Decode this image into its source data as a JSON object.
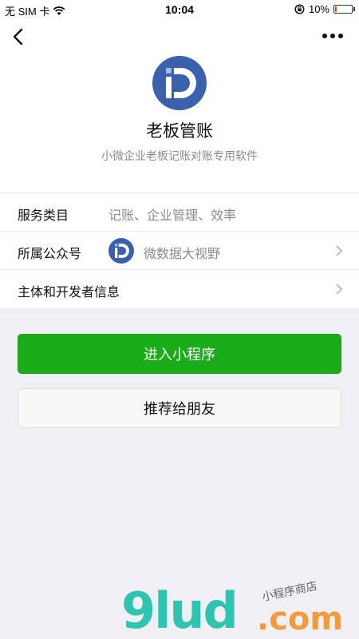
{
  "status_bar": {
    "carrier": "无 SIM 卡",
    "time": "10:04",
    "battery": "10%",
    "battery_level": 0.1
  },
  "nav": {
    "back_icon": "chevron-left-icon",
    "more_icon": "more-dots-icon"
  },
  "app": {
    "name": "老板管账",
    "description": "小微企业老板记账对账专用软件"
  },
  "info": {
    "category_label": "服务类目",
    "category_value": "记账、企业管理、效率",
    "account_label": "所属公众号",
    "account_value": "微数据大视野",
    "developer_label": "主体和开发者信息"
  },
  "actions": {
    "enter_label": "进入小程序",
    "share_label": "推荐给朋友"
  },
  "watermark": {
    "left": "9lud",
    "right": ".com",
    "small": "小程序商店"
  },
  "colors": {
    "primary_green": "#1aad19",
    "logo_blue": "#3a61ad",
    "background": "#efeff4"
  }
}
